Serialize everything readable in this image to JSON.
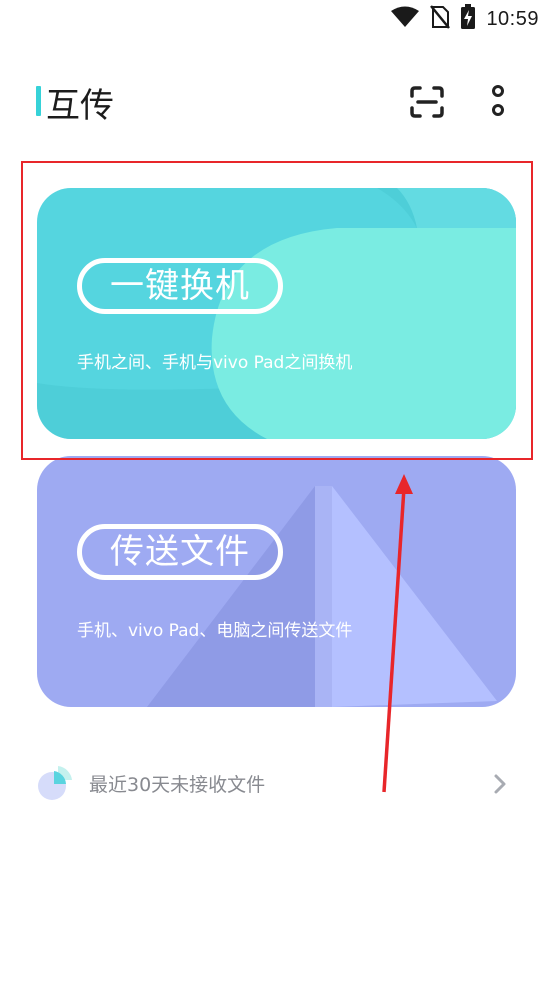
{
  "status_bar": {
    "time": "10:59",
    "icons": [
      "wifi-icon",
      "no-sim-icon",
      "battery-charging-icon"
    ]
  },
  "header": {
    "title": "互传",
    "accent_color": "#36d2d8",
    "actions": [
      "scan-icon",
      "more-icon"
    ]
  },
  "cards": [
    {
      "title": "一键换机",
      "subtitle": "手机之间、手机与vivo Pad之间换机",
      "color": "#55d5df"
    },
    {
      "title": "传送文件",
      "subtitle": "手机、vivo Pad、电脑之间传送文件",
      "color": "#9eaaf2"
    }
  ],
  "recent": {
    "label": "最近30天未接收文件",
    "icon": "pie-chart-icon"
  },
  "annotation": {
    "box_color": "#e8262a",
    "arrow_color": "#e8262a"
  }
}
